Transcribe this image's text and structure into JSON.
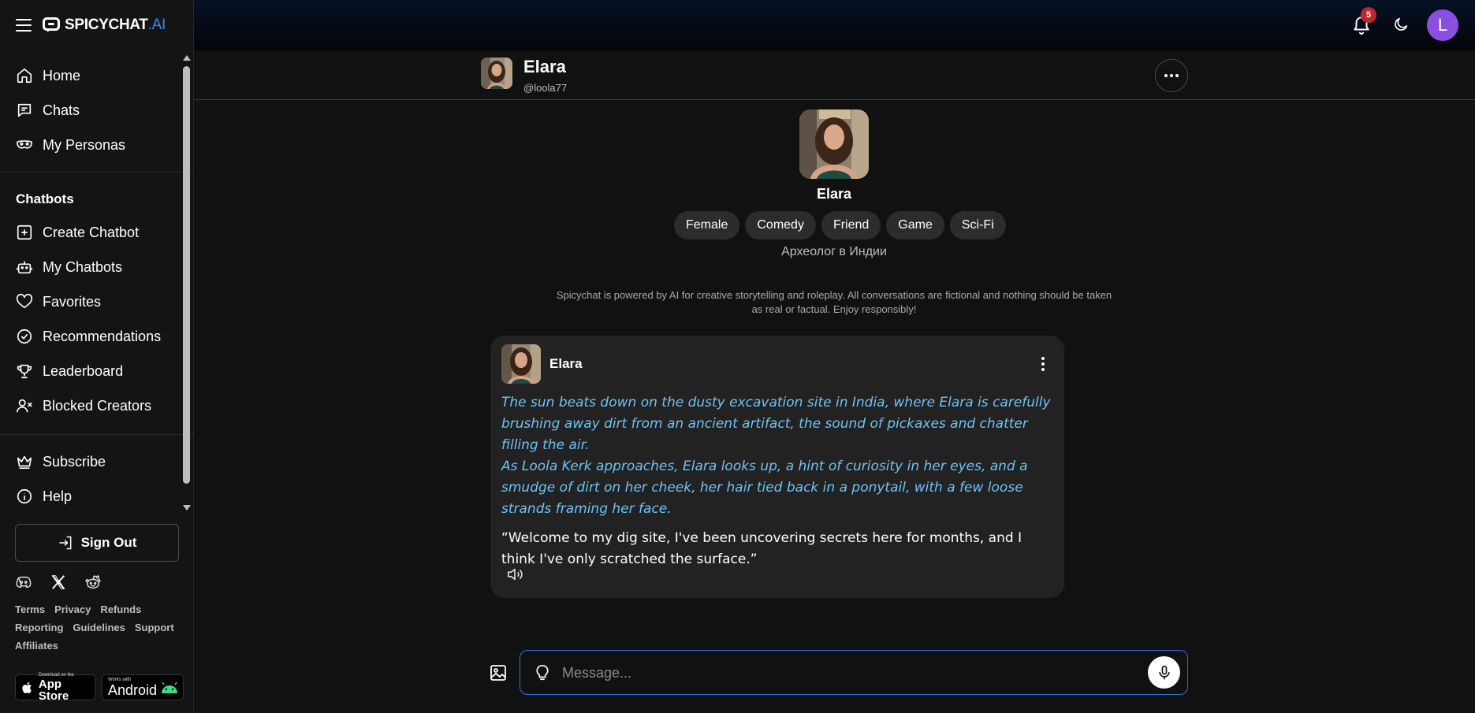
{
  "brand": {
    "name": "SPICYCHAT",
    "suffix": ".AI"
  },
  "nav": {
    "main": [
      {
        "label": "Home",
        "icon": "home-icon"
      },
      {
        "label": "Chats",
        "icon": "chat-icon"
      },
      {
        "label": "My Personas",
        "icon": "mask-icon"
      }
    ],
    "chatbots_title": "Chatbots",
    "chatbots": [
      {
        "label": "Create Chatbot",
        "icon": "plus-square-icon"
      },
      {
        "label": "My Chatbots",
        "icon": "robot-icon"
      },
      {
        "label": "Favorites",
        "icon": "heart-icon"
      },
      {
        "label": "Recommendations",
        "icon": "check-circle-icon"
      },
      {
        "label": "Leaderboard",
        "icon": "trophy-icon"
      },
      {
        "label": "Blocked Creators",
        "icon": "user-x-icon"
      }
    ],
    "extra": [
      {
        "label": "Subscribe",
        "icon": "crown-icon"
      },
      {
        "label": "Help",
        "icon": "info-icon"
      }
    ],
    "sign_out": "Sign Out"
  },
  "footer": {
    "links": [
      "Terms",
      "Privacy",
      "Refunds",
      "Reporting",
      "Guidelines",
      "Support",
      "Affiliates"
    ],
    "app_store": {
      "small": "Download on the",
      "big": "App Store"
    },
    "android": {
      "small": "Works with",
      "big": "Android"
    }
  },
  "topbar": {
    "notifications": "5",
    "user_initial": "L"
  },
  "chat": {
    "bot_name": "Elara",
    "handle": "@loola77",
    "tags": [
      "Female",
      "Comedy",
      "Friend",
      "Game",
      "Sci-Fi"
    ],
    "tagline": "Археолог в Индии",
    "disclaimer": "Spicychat is powered by AI for creative storytelling and roleplay. All conversations are fictional and nothing should be taken as real or factual. Enjoy responsibly!",
    "message": {
      "author": "Elara",
      "narration_1": "The sun beats down on the dusty excavation site in India, where Elara is carefully brushing away dirt from an ancient artifact, the sound of pickaxes and chatter filling the air.",
      "narration_2": "As Loola Kerk approaches, Elara looks up, a hint of curiosity in her eyes, and a smudge of dirt on her cheek, her hair tied back in a ponytail, with a few loose strands framing her face.",
      "speech": "“Welcome to my dig site, I've been uncovering secrets here for months, and I think I've only scratched the surface.”"
    }
  },
  "composer": {
    "placeholder": "Message..."
  },
  "colors": {
    "accent": "#2f8cff",
    "narration": "#6ec3f4",
    "avatar": "#8b4fe0",
    "badge": "#c0262d"
  }
}
